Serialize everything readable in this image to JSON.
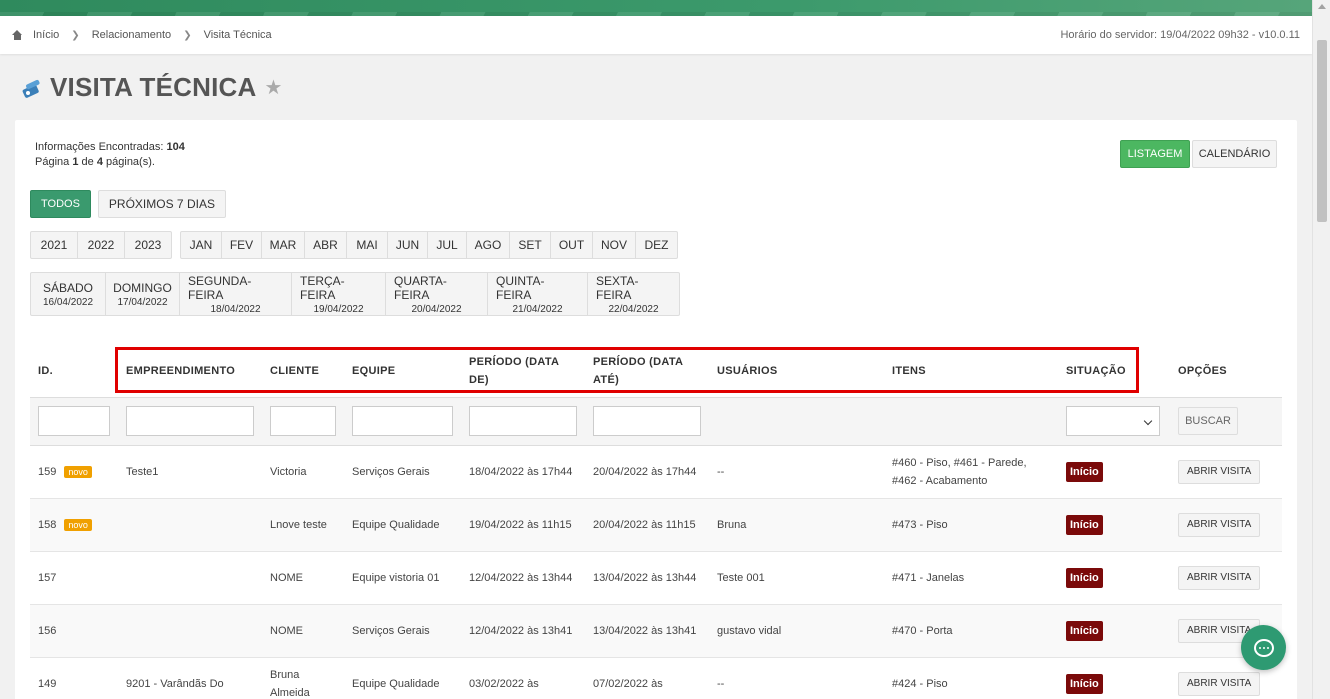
{
  "breadcrumb": {
    "items": [
      "Início",
      "Relacionamento",
      "Visita Técnica"
    ],
    "server_time": "Horário do servidor: 19/04/2022 09h32 - v10.0.11"
  },
  "page": {
    "title": "VISITA TÉCNICA"
  },
  "info": {
    "found_label": "Informações Encontradas:",
    "found_count": "104",
    "page_label_1": "Página",
    "page_current": "1",
    "page_label_2": "de",
    "page_total": "4",
    "page_label_3": "página(s)."
  },
  "view_buttons": {
    "list": "LISTAGEM",
    "calendar": "CALENDÁRIO"
  },
  "filters": {
    "all": "TODOS",
    "next7": "PRÓXIMOS 7 DIAS",
    "years": [
      "2021",
      "2022",
      "2023"
    ],
    "months": [
      "JAN",
      "FEV",
      "MAR",
      "ABR",
      "MAI",
      "JUN",
      "JUL",
      "AGO",
      "SET",
      "OUT",
      "NOV",
      "DEZ"
    ],
    "days": [
      {
        "name": "SÁBADO",
        "date": "16/04/2022"
      },
      {
        "name": "DOMINGO",
        "date": "17/04/2022"
      },
      {
        "name": "SEGUNDA-FEIRA",
        "date": "18/04/2022"
      },
      {
        "name": "TERÇA-FEIRA",
        "date": "19/04/2022"
      },
      {
        "name": "QUARTA-FEIRA",
        "date": "20/04/2022"
      },
      {
        "name": "QUINTA-FEIRA",
        "date": "21/04/2022"
      },
      {
        "name": "SEXTA-FEIRA",
        "date": "22/04/2022"
      }
    ]
  },
  "table": {
    "headers": {
      "id": "ID.",
      "empreendimento": "EMPREENDIMENTO",
      "cliente": "CLIENTE",
      "equipe": "EQUIPE",
      "periodo_de": "PERÍODO (DATA DE)",
      "periodo_ate": "PERÍODO (DATA ATÉ)",
      "usuarios": "USUÁRIOS",
      "itens": "ITENS",
      "situacao": "SITUAÇÃO",
      "opcoes": "OPÇÕES"
    },
    "search_button": "BUSCAR",
    "new_badge": "novo",
    "open_button": "ABRIR VISITA",
    "rows": [
      {
        "id": "159",
        "novo": true,
        "empreendimento": "Teste1",
        "cliente": "Victoria",
        "equipe": "Serviços Gerais",
        "de": "18/04/2022 às 17h44",
        "ate": "20/04/2022 às 17h44",
        "usuarios": "--",
        "itens": "#460 - Piso, #461 - Parede, #462 - Acabamento",
        "situacao": "Início"
      },
      {
        "id": "158",
        "novo": true,
        "empreendimento": "",
        "cliente": "Lnove teste",
        "equipe": "Equipe Qualidade",
        "de": "19/04/2022 às 11h15",
        "ate": "20/04/2022 às 11h15",
        "usuarios": "Bruna",
        "itens": "#473 - Piso",
        "situacao": "Início"
      },
      {
        "id": "157",
        "novo": false,
        "empreendimento": "",
        "cliente": "NOME",
        "equipe": "Equipe vistoria 01",
        "de": "12/04/2022 às 13h44",
        "ate": "13/04/2022 às 13h44",
        "usuarios": "Teste 001",
        "itens": "#471 - Janelas",
        "situacao": "Início"
      },
      {
        "id": "156",
        "novo": false,
        "empreendimento": "",
        "cliente": "NOME",
        "equipe": "Serviços Gerais",
        "de": "12/04/2022 às 13h41",
        "ate": "13/04/2022 às 13h41",
        "usuarios": "gustavo vidal",
        "itens": "#470 - Porta",
        "situacao": "Início"
      },
      {
        "id": "149",
        "novo": false,
        "empreendimento": "9201 - Varândãs Do",
        "cliente": "Bruna Almeida",
        "equipe": "Equipe Qualidade",
        "de": "03/02/2022 às",
        "ate": "07/02/2022 às",
        "usuarios": "--",
        "itens": "#424 - Piso",
        "situacao": "Início"
      }
    ]
  }
}
